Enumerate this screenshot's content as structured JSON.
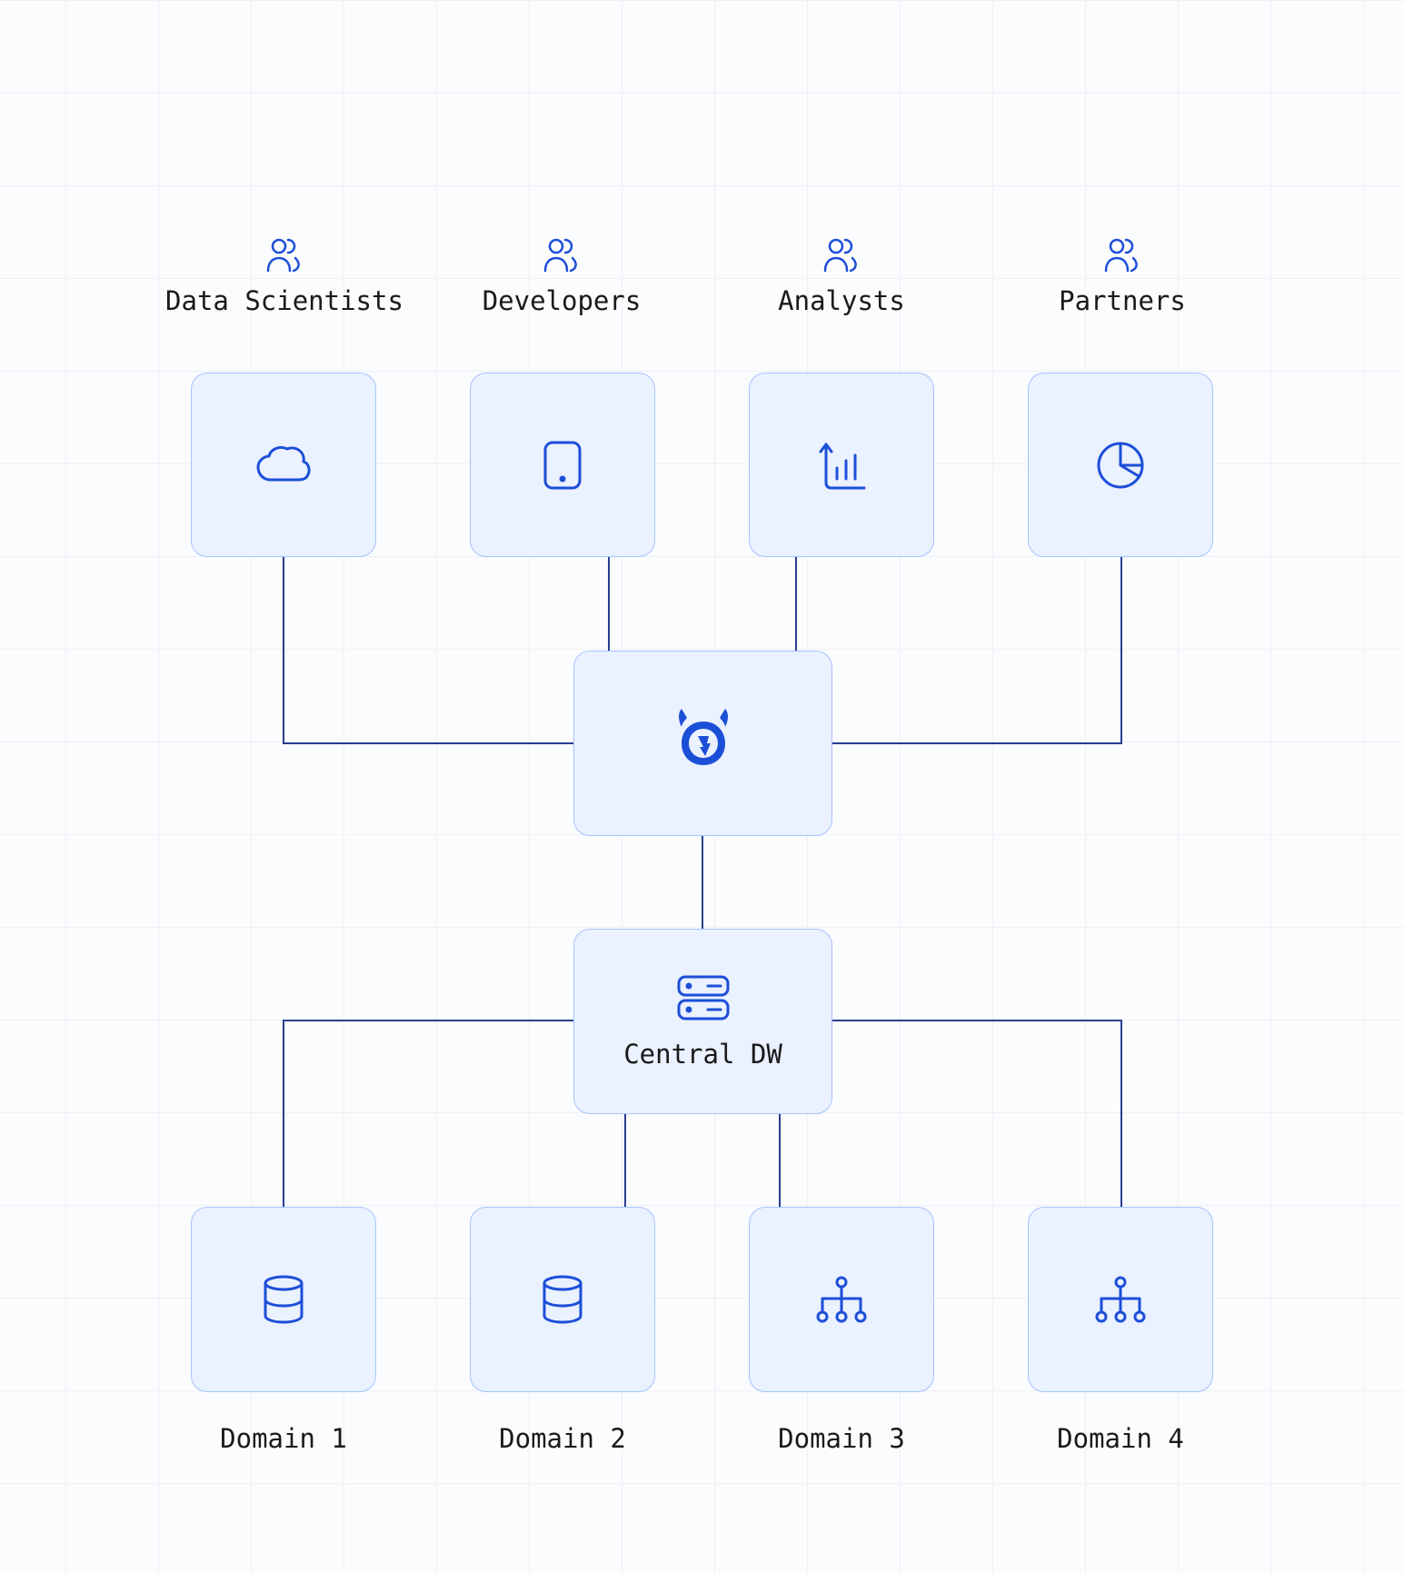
{
  "personas": {
    "data_scientists": "Data Scientists",
    "developers": "Developers",
    "analysts": "Analysts",
    "partners": "Partners"
  },
  "nodes": {
    "central_dw": "Central DW"
  },
  "domains": {
    "d1": "Domain 1",
    "d2": "Domain 2",
    "d3": "Domain 3",
    "d4": "Domain 4"
  },
  "icons": {
    "persona": "users-icon",
    "consumer1": "cloud-icon",
    "consumer2": "tablet-icon",
    "consumer3": "chart-bar-up-icon",
    "consumer4": "pie-chart-icon",
    "hub": "hasura-icon",
    "dw": "server-icon",
    "domain_db": "database-icon",
    "domain_tree": "hierarchy-icon"
  },
  "colors": {
    "node_border": "#a6c3ff",
    "node_fill": "#eaf1ff",
    "icon_stroke": "#1c4fd8",
    "connector": "#2a3e8f",
    "text": "#1a1a1a"
  }
}
